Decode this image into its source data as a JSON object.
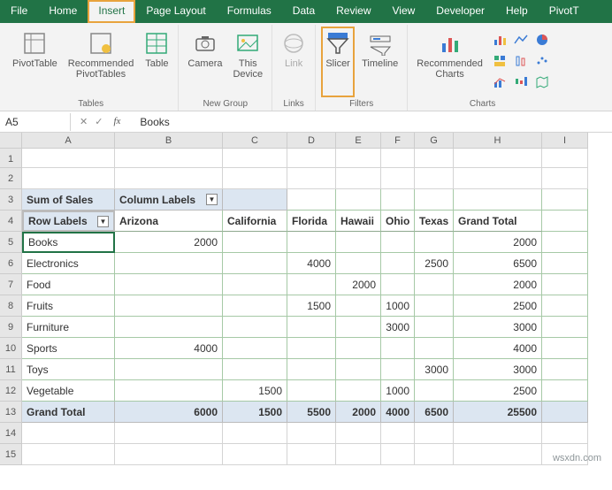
{
  "tabs": [
    "File",
    "Home",
    "Insert",
    "Page Layout",
    "Formulas",
    "Data",
    "Review",
    "View",
    "Developer",
    "Help",
    "PivotT"
  ],
  "activeTab": "Insert",
  "ribbonGroups": {
    "tables": {
      "label": "Tables",
      "buttons": [
        "PivotTable",
        "Recommended\nPivotTables",
        "Table"
      ]
    },
    "newgroup": {
      "label": "New Group",
      "buttons": [
        "Camera",
        "This\nDevice"
      ]
    },
    "links": {
      "label": "Links",
      "buttons": [
        "Link"
      ]
    },
    "filters": {
      "label": "Filters",
      "buttons": [
        "Slicer",
        "Timeline"
      ]
    },
    "charts": {
      "label": "Charts",
      "buttons": [
        "Recommended\nCharts"
      ]
    }
  },
  "nameBox": "A5",
  "formulaValue": "Books",
  "columns": [
    "A",
    "B",
    "C",
    "D",
    "E",
    "F",
    "G",
    "H",
    "I"
  ],
  "pivot": {
    "sumLabel": "Sum of Sales",
    "colLabelsLabel": "Column Labels",
    "rowLabelsLabel": "Row Labels",
    "colHeaders": [
      "Arizona",
      "California",
      "Florida",
      "Hawaii",
      "Ohio",
      "Texas",
      "Grand Total"
    ],
    "rows": [
      {
        "label": "Books",
        "vals": [
          "2000",
          "",
          "",
          "",
          "",
          "",
          "2000"
        ]
      },
      {
        "label": "Electronics",
        "vals": [
          "",
          "",
          "4000",
          "",
          "",
          "2500",
          "6500"
        ]
      },
      {
        "label": "Food",
        "vals": [
          "",
          "",
          "",
          "2000",
          "",
          "",
          "2000"
        ]
      },
      {
        "label": "Fruits",
        "vals": [
          "",
          "",
          "1500",
          "",
          "1000",
          "",
          "2500"
        ]
      },
      {
        "label": "Furniture",
        "vals": [
          "",
          "",
          "",
          "",
          "3000",
          "",
          "3000"
        ]
      },
      {
        "label": "Sports",
        "vals": [
          "4000",
          "",
          "",
          "",
          "",
          "",
          "4000"
        ]
      },
      {
        "label": "Toys",
        "vals": [
          "",
          "",
          "",
          "",
          "",
          "3000",
          "3000"
        ]
      },
      {
        "label": "Vegetable",
        "vals": [
          "",
          "1500",
          "",
          "",
          "1000",
          "",
          "2500"
        ]
      }
    ],
    "grandTotal": {
      "label": "Grand Total",
      "vals": [
        "6000",
        "1500",
        "5500",
        "2000",
        "4000",
        "6500",
        "25500"
      ]
    }
  },
  "watermark": "wsxdn.com",
  "chart_data": {
    "type": "table",
    "title": "Sum of Sales",
    "columns": [
      "Arizona",
      "California",
      "Florida",
      "Hawaii",
      "Ohio",
      "Texas",
      "Grand Total"
    ],
    "rows": [
      "Books",
      "Electronics",
      "Food",
      "Fruits",
      "Furniture",
      "Sports",
      "Toys",
      "Vegetable",
      "Grand Total"
    ],
    "data": [
      [
        2000,
        null,
        null,
        null,
        null,
        null,
        2000
      ],
      [
        null,
        null,
        4000,
        null,
        null,
        2500,
        6500
      ],
      [
        null,
        null,
        null,
        2000,
        null,
        null,
        2000
      ],
      [
        null,
        null,
        1500,
        null,
        1000,
        null,
        2500
      ],
      [
        null,
        null,
        null,
        null,
        3000,
        null,
        3000
      ],
      [
        4000,
        null,
        null,
        null,
        null,
        null,
        4000
      ],
      [
        null,
        null,
        null,
        null,
        null,
        3000,
        3000
      ],
      [
        null,
        1500,
        null,
        null,
        1000,
        null,
        2500
      ],
      [
        6000,
        1500,
        5500,
        2000,
        4000,
        6500,
        25500
      ]
    ]
  }
}
